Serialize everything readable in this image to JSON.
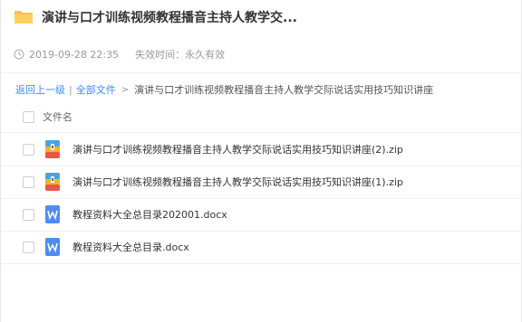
{
  "header": {
    "title": "演讲与口才训练视频教程播音主持人教学交...",
    "date": "2019-09-28 22:35",
    "expiry": "失效时间：永久有效"
  },
  "breadcrumb": {
    "back": "返回上一级",
    "separator": "|",
    "all_files": "全部文件",
    "arrow": ">",
    "current": "演讲与口才训练视频教程播音主持人教学交际说话实用技巧知识讲座"
  },
  "list": {
    "column_header": "文件名",
    "files": [
      {
        "name": "演讲与口才训练视频教程播音主持人教学交际说话实用技巧知识讲座(2).zip",
        "icon": "zip-file-icon"
      },
      {
        "name": "演讲与口才训练视频教程播音主持人教学交际说话实用技巧知识讲座(1).zip",
        "icon": "zip-file-icon"
      },
      {
        "name": "教程资料大全总目录202001.docx",
        "icon": "word-file-icon"
      },
      {
        "name": "教程资料大全总目录.docx",
        "icon": "word-file-icon"
      }
    ]
  },
  "colors": {
    "link": "#3b8cff",
    "folder": "#f7c34c",
    "word": "#4d8cf5"
  }
}
